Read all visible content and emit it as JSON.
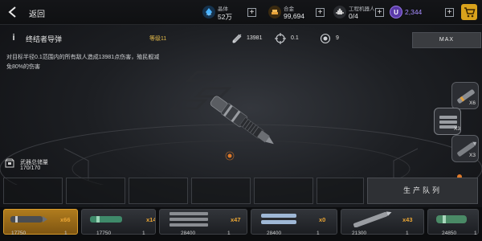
{
  "header": {
    "back_label": "返回",
    "resources": [
      {
        "id": "crystal",
        "icon": "crystal-icon",
        "label": "晶体",
        "value": "52万",
        "color": "#3da8ff"
      },
      {
        "id": "alloy",
        "icon": "alloy-icon",
        "label": "合金",
        "value": "99,694",
        "color": "#e8a23a"
      },
      {
        "id": "robot",
        "icon": "robot-icon",
        "label": "工程机器人",
        "value": "0/4",
        "color": "#d0d0d0"
      },
      {
        "id": "premium",
        "icon": "u-coin-icon",
        "value": "2,344",
        "color": "#7a4fd6"
      }
    ],
    "cart_icon": "cart-icon"
  },
  "item": {
    "name": "终结者导弹",
    "level": "等级11",
    "stats": [
      {
        "icon": "damage-icon",
        "value": "13981"
      },
      {
        "icon": "crosshair-icon",
        "value": "0.1"
      },
      {
        "icon": "target-icon",
        "value": "9"
      }
    ],
    "max_label": "MAX",
    "description_line1": "对目标半径0.1范围内的所有敌人造成13981点伤害，殖民舰减",
    "description_line2": "免80%的伤害"
  },
  "storage": {
    "label": "武器总储量",
    "count": "170/170"
  },
  "queue": {
    "button_label": "生产队列"
  },
  "variants": [
    {
      "count": "X6"
    },
    {
      "count": "X3"
    },
    {
      "count": "X3"
    }
  ],
  "inventory": [
    {
      "qty": "x66",
      "value": "17750",
      "sub": "1",
      "selected": true
    },
    {
      "qty": "x14",
      "value": "17750",
      "sub": "1",
      "selected": false
    },
    {
      "qty": "x47",
      "value": "28400",
      "sub": "1",
      "selected": false
    },
    {
      "qty": "x0",
      "value": "28400",
      "sub": "1",
      "selected": false
    },
    {
      "qty": "x43",
      "value": "21300",
      "sub": "1",
      "selected": false
    },
    {
      "qty": "",
      "value": "24850",
      "sub": "1",
      "selected": false
    }
  ]
}
